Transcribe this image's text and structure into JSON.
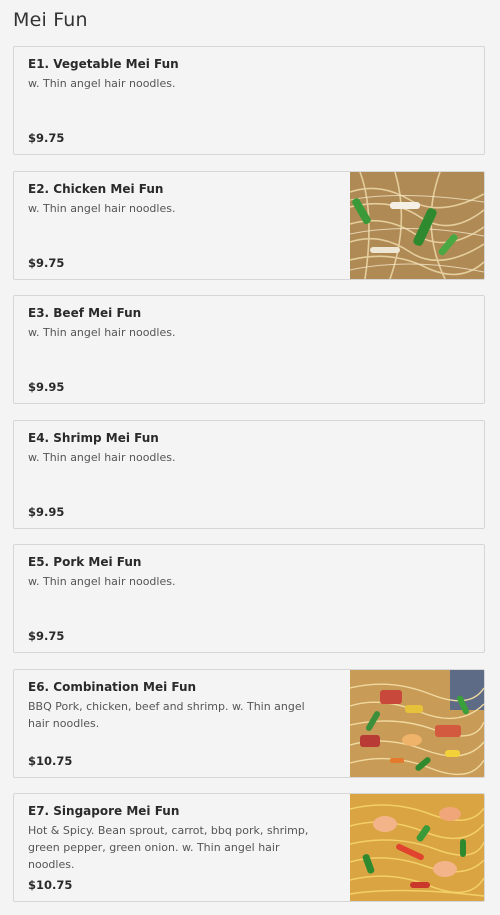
{
  "section": {
    "title": "Mei Fun"
  },
  "items": [
    {
      "name": "E1. Vegetable Mei Fun",
      "desc": "w. Thin angel hair noodles.",
      "price": "$9.75",
      "photo": "none"
    },
    {
      "name": "E2. Chicken Mei Fun",
      "desc": "w. Thin angel hair noodles.",
      "price": "$9.75",
      "photo": "chicken-mei-fun-photo"
    },
    {
      "name": "E3. Beef Mei Fun",
      "desc": "w. Thin angel hair noodles.",
      "price": "$9.95",
      "photo": "none"
    },
    {
      "name": "E4. Shrimp Mei Fun",
      "desc": "w. Thin angel hair noodles.",
      "price": "$9.95",
      "photo": "none"
    },
    {
      "name": "E5. Pork Mei Fun",
      "desc": "w. Thin angel hair noodles.",
      "price": "$9.75",
      "photo": "none"
    },
    {
      "name": "E6. Combination Mei Fun",
      "desc": "BBQ Pork, chicken, beef and shrimp. w. Thin angel hair noodles.",
      "price": "$10.75",
      "photo": "combination-mei-fun-photo"
    },
    {
      "name": "E7. Singapore Mei Fun",
      "desc": "Hot & Spicy. Bean sprout, carrot, bbq pork, shrimp, green pepper, green onion. w. Thin angel hair noodles.",
      "price": "$10.75",
      "photo": "singapore-mei-fun-photo"
    }
  ]
}
